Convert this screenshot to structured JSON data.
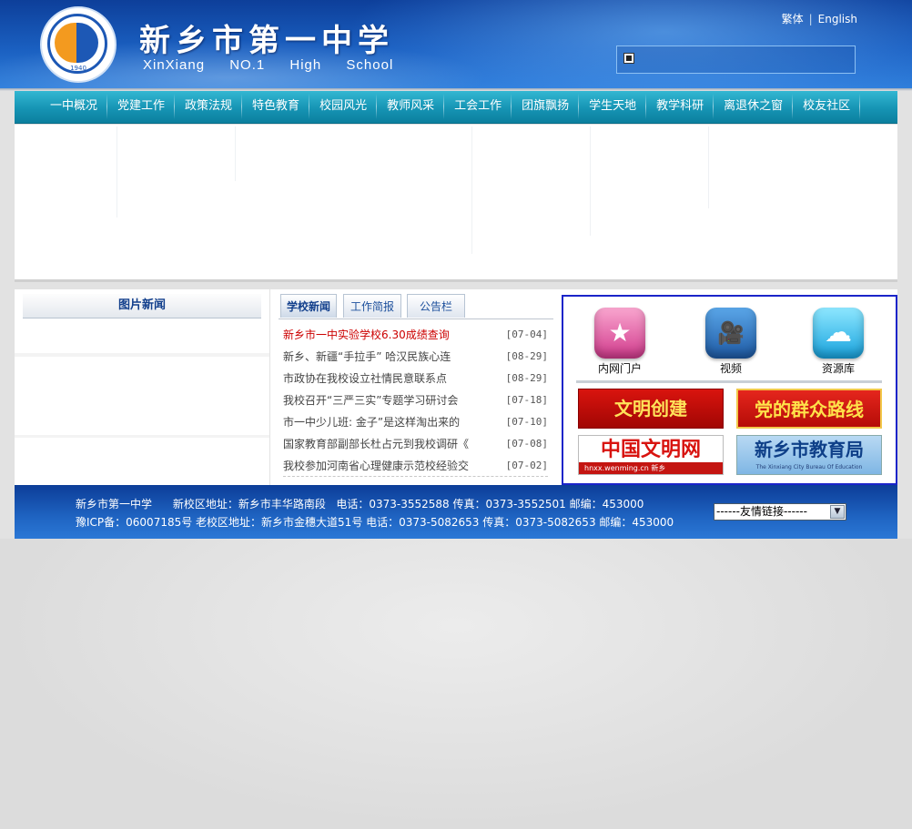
{
  "header": {
    "school_name_cn": "新乡市第一中学",
    "school_name_en": "XinXiang NO.1 High School",
    "logo_year": "1940",
    "lang_traditional": "繁体",
    "lang_separator": "|",
    "lang_english": "English"
  },
  "nav": {
    "items": [
      "一中概况",
      "党建工作",
      "政策法规",
      "特色教育",
      "校园风光",
      "教师风采",
      "工会工作",
      "团旗飘扬",
      "学生天地",
      "教学科研",
      "离退休之窗",
      "校友社区"
    ]
  },
  "pic_news": {
    "title": "图片新闻"
  },
  "news": {
    "tabs": [
      "学校新闻",
      "工作简报",
      "公告栏"
    ],
    "active_tab": "学校新闻",
    "items": [
      {
        "title": "新乡市一中实验学校6.30成绩查询",
        "date": "[07-04]",
        "highlight": true
      },
      {
        "title": "新乡、新疆“手拉手” 哈汉民族心连",
        "date": "[08-29]"
      },
      {
        "title": "市政协在我校设立社情民意联系点",
        "date": "[08-29]"
      },
      {
        "title": "我校召开“三严三实”专题学习研讨会",
        "date": "[07-18]"
      },
      {
        "title": "市一中少儿班: 金子”是这样淘出来的",
        "date": "[07-10]"
      },
      {
        "title": "国家教育部副部长杜占元到我校调研《",
        "date": "[07-08]"
      },
      {
        "title": "我校参加河南省心理健康示范校经验交",
        "date": "[07-02]"
      }
    ]
  },
  "quick_links": {
    "icons": [
      {
        "label": "内网门户",
        "icon": "star-icon",
        "color": "#d13a8c"
      },
      {
        "label": "视频",
        "icon": "video-camera-icon",
        "color": "#1e5aa5"
      },
      {
        "label": "资源库",
        "icon": "cloud-icon",
        "color": "#18a3de"
      }
    ],
    "banners": {
      "wenming": "文明创建",
      "dang": "党的群众路线",
      "cn_wenming": "中国文明网",
      "cn_wenming_sub": "hnxx.wenming.cn   新乡",
      "edu": "新乡市教育局",
      "edu_sub": "The Xinxiang City Bureau Of Education"
    }
  },
  "footer": {
    "line1": "新乡市第一中学      新校区地址：新乡市丰华路南段   电话：0373-3552588 传真：0373-3552501 邮编：453000",
    "line2": "豫ICP备：06007185号 老校区地址：新乡市金穗大道51号 电话：0373-5082653 传真：0373-5082653 邮编：453000",
    "friend_links": "------友情链接------"
  },
  "colors": {
    "header_blue": "#1a5fc0",
    "nav_teal": "#1694b4",
    "highlight_red": "#cc0000",
    "links_border": "#1a24c9"
  }
}
